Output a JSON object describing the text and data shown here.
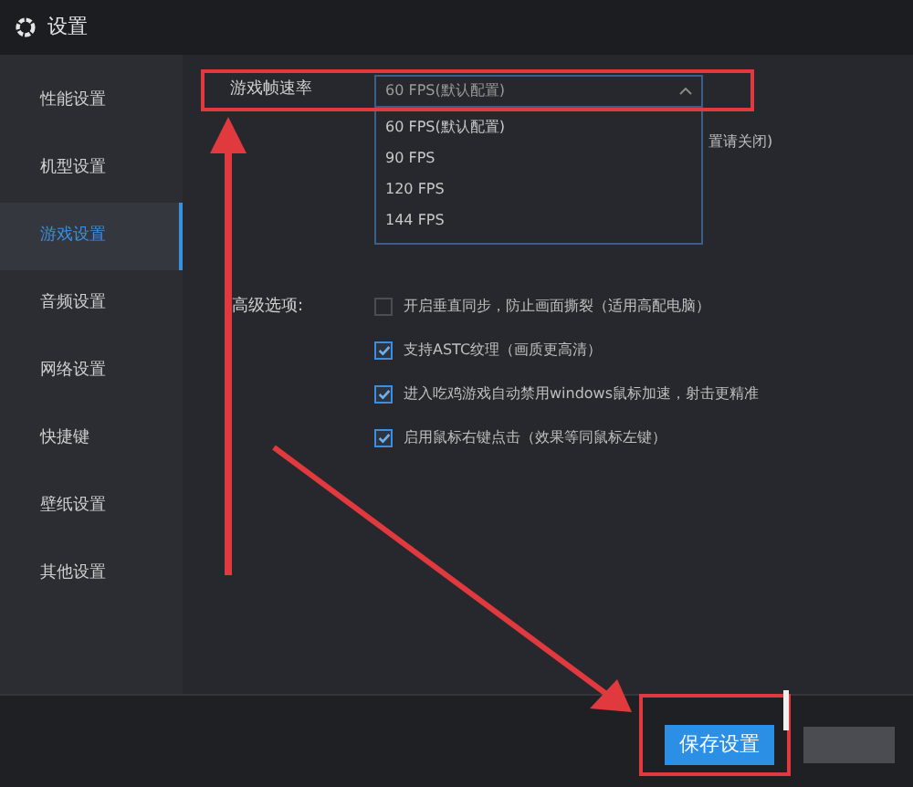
{
  "window": {
    "title": "设置"
  },
  "sidebar": {
    "items": [
      {
        "label": "性能设置",
        "selected": false
      },
      {
        "label": "机型设置",
        "selected": false
      },
      {
        "label": "游戏设置",
        "selected": true
      },
      {
        "label": "音频设置",
        "selected": false
      },
      {
        "label": "网络设置",
        "selected": false
      },
      {
        "label": "快捷键",
        "selected": false
      },
      {
        "label": "壁纸设置",
        "selected": false
      },
      {
        "label": "其他设置",
        "selected": false
      }
    ]
  },
  "frame_rate": {
    "label": "游戏帧速率",
    "value": "60 FPS(默认配置)",
    "expanded": true,
    "options": [
      {
        "label": "60 FPS(默认配置)"
      },
      {
        "label": "90 FPS"
      },
      {
        "label": "120 FPS"
      },
      {
        "label": "144 FPS"
      }
    ]
  },
  "hidden_note": "置请关闭)",
  "advanced": {
    "label": "高级选项:",
    "options": [
      {
        "label": "开启垂直同步，防止画面撕裂（适用高配电脑）",
        "checked": false
      },
      {
        "label": "支持ASTC纹理（画质更高清）",
        "checked": true
      },
      {
        "label": "进入吃鸡游戏自动禁用windows鼠标加速，射击更精准",
        "checked": true
      },
      {
        "label": "启用鼠标右键点击（效果等同鼠标左键）",
        "checked": true
      }
    ]
  },
  "footer": {
    "save": "保存设置"
  }
}
